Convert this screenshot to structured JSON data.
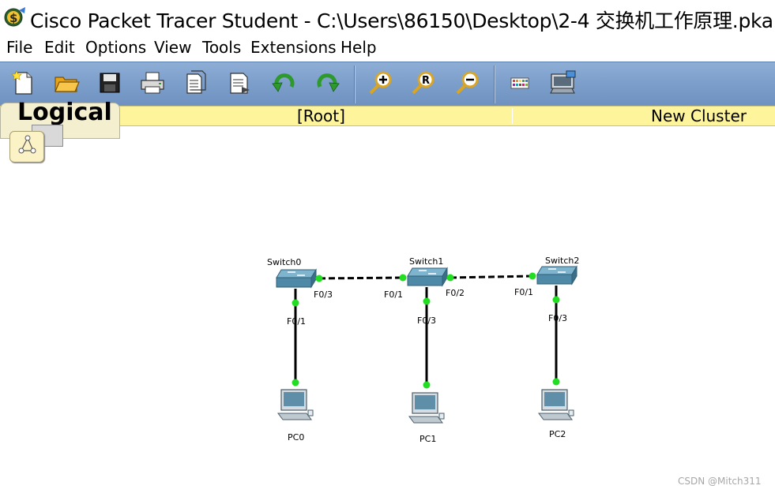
{
  "window": {
    "title": "Cisco Packet Tracer Student - C:\\Users\\86150\\Desktop\\2-4 交换机工作原理.pka"
  },
  "menu": [
    "File",
    "Edit",
    "Options",
    "View",
    "Tools",
    "Extensions",
    "Help"
  ],
  "toolbar": {
    "buttons": [
      "new-icon",
      "open-folder-icon",
      "save-icon",
      "print-icon",
      "activity-wizard-icon",
      "custom-device-icon",
      "undo-icon",
      "redo-icon",
      "zoom-in-icon",
      "zoom-reset-icon",
      "zoom-out-icon",
      "palette-icon",
      "custom-device-dialog-icon"
    ]
  },
  "workspace_bar": {
    "mode": "Logical",
    "root": "[Root]",
    "cluster": "New Cluster"
  },
  "topology": {
    "switches": [
      {
        "name": "Switch0"
      },
      {
        "name": "Switch1"
      },
      {
        "name": "Switch2"
      }
    ],
    "pcs": [
      {
        "name": "PC0"
      },
      {
        "name": "PC1"
      },
      {
        "name": "PC2"
      }
    ],
    "ports": {
      "sw0_pc": "F0/1",
      "sw0_sw1": "F0/3",
      "sw1_sw0": "F0/1",
      "sw1_sw2": "F0/2",
      "sw1_pc": "F0/3",
      "sw2_sw1": "F0/1",
      "sw2_pc": "F0/3"
    },
    "link_color": "#000000",
    "port_up_color": "#22dd22"
  },
  "watermark": "CSDN @Mitch311"
}
